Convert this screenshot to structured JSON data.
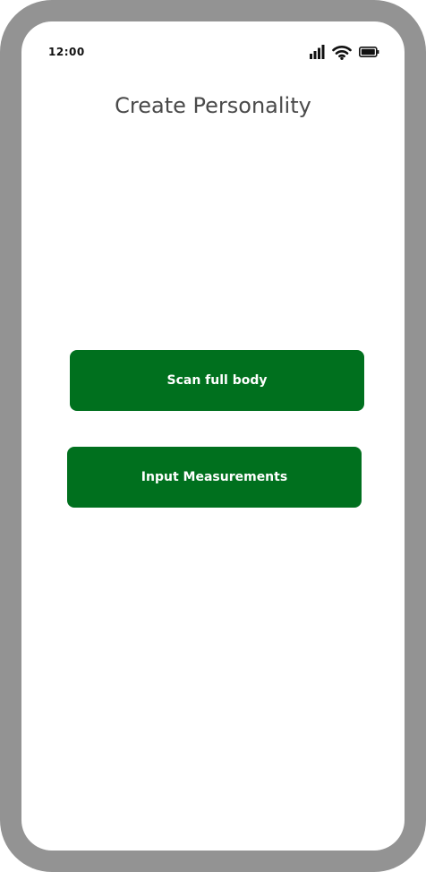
{
  "status_bar": {
    "time": "12:00",
    "icons": [
      "signal-icon",
      "wifi-icon",
      "battery-icon"
    ]
  },
  "header": {
    "title": "Create Personality"
  },
  "actions": {
    "scan_label": "Scan full body",
    "measurements_label": "Input Measurements"
  },
  "colors": {
    "accent": "#00701e",
    "frame": "#939393",
    "title_text": "#4a4a4a"
  }
}
